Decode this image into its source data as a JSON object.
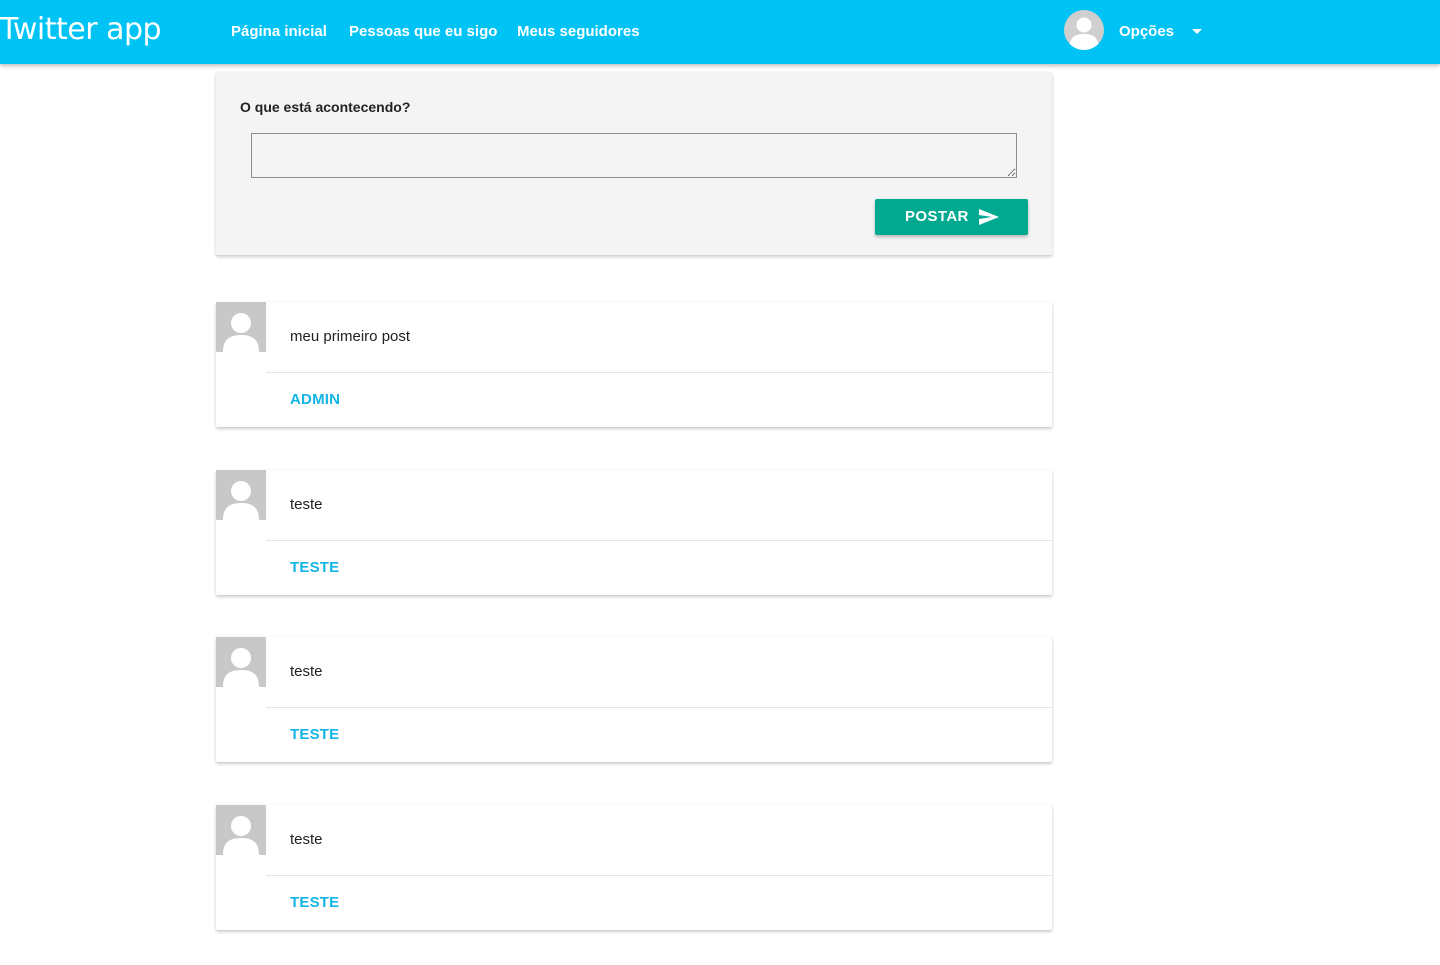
{
  "navbar": {
    "brand": "Twitter app",
    "links": [
      {
        "label": "Página inicial"
      },
      {
        "label": "Pessoas que eu sigo"
      },
      {
        "label": "Meus seguidores"
      }
    ],
    "options_label": "Opções",
    "avatar_icon": "user-avatar-icon",
    "caret_icon": "caret-down-icon"
  },
  "compose": {
    "label": "O que está acontecendo?",
    "value": "",
    "placeholder": "",
    "button_label": "POSTAR",
    "button_icon": "send-icon"
  },
  "posts": [
    {
      "text": "meu primeiro post",
      "author": "ADMIN"
    },
    {
      "text": "teste",
      "author": "TESTE"
    },
    {
      "text": "teste",
      "author": "TESTE"
    },
    {
      "text": "teste",
      "author": "TESTE"
    }
  ],
  "colors": {
    "navbar": "#00c3f5",
    "post_button": "#00a98f",
    "author_link": "#12b5e6",
    "compose_background": "#f4f4f4",
    "avatar_placeholder": "#c8c8c8"
  }
}
